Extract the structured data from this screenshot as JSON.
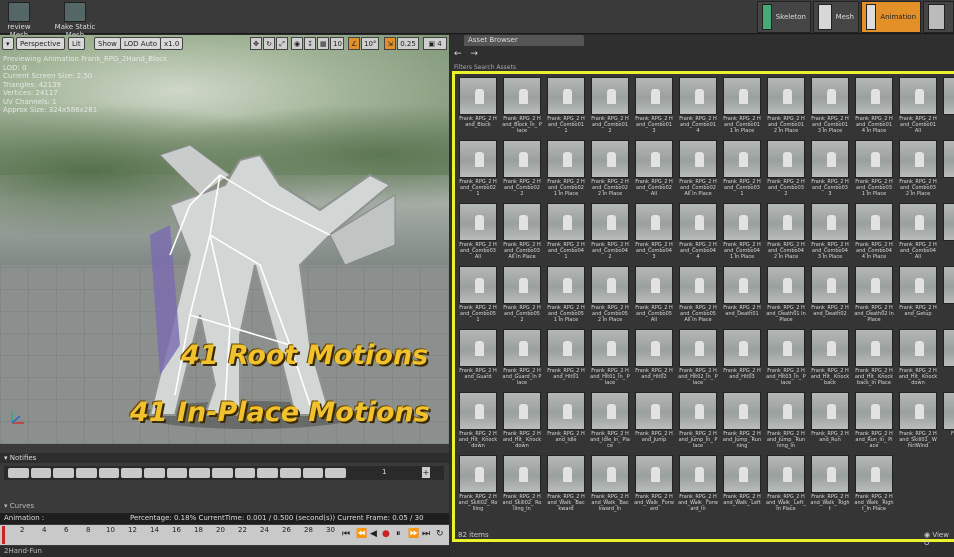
{
  "toolbar": {
    "preview_mesh": "review Mesh",
    "make_static_mesh": "Make Static Mesh",
    "mode_skeleton": "Skeleton",
    "mode_mesh": "Mesh",
    "mode_animation": "Animation",
    "colors": {
      "accent": "#e39028"
    }
  },
  "viewport": {
    "btn_perspective": "Perspective",
    "btn_lit": "Lit",
    "btn_show": "Show",
    "btn_lod": "LOD Auto",
    "speed": "x1.0",
    "grid_size": "10",
    "angle": "10°",
    "scale": "0.25",
    "cam_speed": "4",
    "preview_text": "Previewing Animation Frank_RPG_2Hand_Block",
    "stats": [
      "LOD: 0",
      "Current Screen Size: 2.50",
      "Triangles: 42139",
      "Vertices: 24117",
      "UV Channels: 1",
      "Approx Size: 324x586x281"
    ],
    "overlay_root": "41 Root Motions",
    "overlay_inplace": "41 In-Place Motions"
  },
  "bottom": {
    "notifies": "Notifies",
    "track_num": "1",
    "curves": "Curves",
    "animation": "Animation : Frank_RPG_2Hand_Block",
    "percentage": "Percentage: 0.18% CurrentTime: 0.001 / 0.500 (second(s)) Current Frame: 0.05 / 30 Frames",
    "ticks": [
      "2",
      "4",
      "6",
      "8",
      "10",
      "12",
      "14",
      "16",
      "18",
      "20",
      "22",
      "24",
      "26",
      "28",
      "30"
    ],
    "status": "2Hand-Fun"
  },
  "asset_browser": {
    "tab": "Asset Browser",
    "filter": "Filters   Search Assets",
    "items_count": "82 items",
    "view_options": "View O",
    "items": [
      "Frank_RPG_2 Hand_Block",
      "Frank_RPG_2 Hand_Block_In_ Place",
      "Frank_RPG_2 Hand_Combo01 1",
      "Frank_RPG_2 Hand_Combo01 2",
      "Frank_RPG_2 Hand_Combo01 3",
      "Frank_RPG_2 Hand_Combo01 4",
      "Frank_RPG_2 Hand_Combo01 1 In Place",
      "Frank_RPG_2 Hand_Combo01 2 In Place",
      "Frank_RPG_2 Hand_Combo01 3 In Place",
      "Frank_RPG_2 Hand_Combo01 4 In Place",
      "Frank_RPG_2 Hand_Combo01 All",
      "Fran",
      "Frank_RPG_2 Hand_Combo02 1",
      "Frank_RPG_2 Hand_Combo02 2",
      "Frank_RPG_2 Hand_Combo02 1 In Place",
      "Frank_RPG_2 Hand_Combo02 2 In Place",
      "Frank_RPG_2 Hand_Combo02 All",
      "Frank_RPG_2 Hand_Combo02 All In Place",
      "Frank_RPG_2 Hand_Combo03 1",
      "Frank_RPG_2 Hand_Combo03 2",
      "Frank_RPG_2 Hand_Combo03 3",
      "Frank_RPG_2 Hand_Combo03 1 In Place",
      "Frank_RPG_2 Hand_Combo03 2 In Place",
      "Fran 3",
      "Frank_RPG_2 Hand_Combo03 All",
      "Frank_RPG_2 Hand_Combo03 All In Place",
      "Frank_RPG_2 Hand_Combo04 1",
      "Frank_RPG_2 Hand_Combo04 2",
      "Frank_RPG_2 Hand_Combo04 3",
      "Frank_RPG_2 Hand_Combo04 4",
      "Frank_RPG_2 Hand_Combo04 1 In Place",
      "Frank_RPG_2 Hand_Combo04 2 In Place",
      "Frank_RPG_2 Hand_Combo04 3 In Place",
      "Frank_RPG_2 Hand_Combo04 4 In Place",
      "Frank_RPG_2 Hand_Combo04 All",
      "Fran",
      "Frank_RPG_2 Hand_Combo05 1",
      "Frank_RPG_2 Hand_Combo05 2",
      "Frank_RPG_2 Hand_Combo05 1 In Place",
      "Frank_RPG_2 Hand_Combo05 2 In Place",
      "Frank_RPG_2 Hand_Combo05 All",
      "Frank_RPG_2 Hand_Combo05 All In Place",
      "Frank_RPG_2 Hand_Death01",
      "Frank_RPG_2 Hand_Death01 In Place",
      "Frank_RPG_2 Hand_Death02",
      "Frank_RPG_2 Hand_Death02 In Place",
      "Frank_RPG_2 Hand_Getup",
      "Fran",
      "Frank_RPG_2 Hand_Guard",
      "Frank_RPG_2 Hand_Guard_In Place",
      "Frank_RPG_2 Hand_Hit01",
      "Frank_RPG_2 Hand_Hit01_In_ Place",
      "Frank_RPG_2 Hand_Hit02",
      "Frank_RPG_2 Hand_Hit02_In_ Place",
      "Frank_RPG_2 Hand_Hit03",
      "Frank_RPG_2 Hand_Hit03_In_ Place",
      "Frank_RPG_2 Hand_Hit_ Knockback",
      "Frank_RPG_2 Hand_Hit_ Knockback_In Place",
      "Frank_RPG_2 Hand_Hit_ Knockdown",
      "Fran",
      "Frank_RPG_2 Hand_Hit_ Knockdown",
      "Frank_RPG_2 Hand_Hit_ Knockdown",
      "Frank_RPG_2 Hand_Idle",
      "Frank_RPG_2 Hand_Idle_In_ Place",
      "Frank_RPG_2 Hand_Jump",
      "Frank_RPG_2 Hand_Jump_In_ Place",
      "Frank_RPG_2 Hand_Jump_ Running",
      "Frank_RPG_2 Hand_Jump_ Running_In",
      "Frank_RPG_2 Hand_Run",
      "Frank_RPG_2 Hand_Run_In_ Place",
      "Frank_RPG_2 Hand_Skill01_ WhirlWind",
      "Fran Whi",
      "Frank_RPG_2 Hand_Skill02_ Rolling",
      "Frank_RPG_2 Hand_Skill02_ Rolling_In",
      "Frank_RPG_2 Hand_Walk_ Backward",
      "Frank_RPG_2 Hand_Walk_ Backward_In",
      "Frank_RPG_2 Hand_Walk_ Forward",
      "Frank_RPG_2 Hand_Walk_ Forward_In",
      "Frank_RPG_2 Hand_Walk_ Left",
      "Frank_RPG_2 Hand_Walk_ Left_In Place",
      "Frank_RPG_2 Hand_Walk_ Right",
      "Frank_RPG_2 Hand_Walk_ Right_In Place",
      "",
      ""
    ]
  }
}
